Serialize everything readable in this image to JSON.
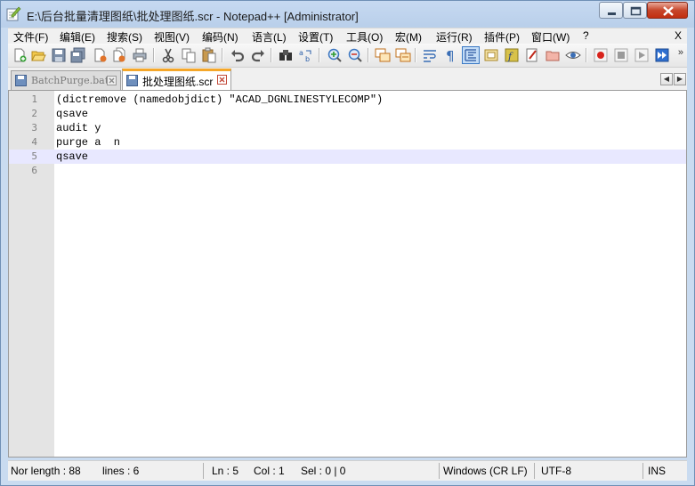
{
  "window": {
    "title": "E:\\后台批量清理图纸\\批处理图纸.scr - Notepad++ [Administrator]"
  },
  "menu": {
    "items": [
      "文件(F)",
      "编辑(E)",
      "搜索(S)",
      "视图(V)",
      "编码(N)",
      "语言(L)",
      "设置(T)",
      "工具(O)",
      "宏(M)",
      "运行(R)",
      "插件(P)",
      "窗口(W)",
      "?"
    ],
    "close": "X"
  },
  "toolbar": {
    "icons": [
      "new-file-icon",
      "open-file-icon",
      "save-icon",
      "save-all-icon",
      "close-icon",
      "close-all-icon",
      "print-icon",
      "cut-icon",
      "copy-icon",
      "paste-icon",
      "undo-icon",
      "redo-icon",
      "find-icon",
      "replace-icon",
      "zoom-in-icon",
      "zoom-out-icon",
      "sync-vertical-icon",
      "sync-horizontal-icon",
      "word-wrap-icon",
      "show-all-chars-icon",
      "indent-guide-icon",
      "document-map-icon",
      "function-list-icon",
      "doc-monitor-icon",
      "folder-workspace-icon",
      "eye-icon",
      "record-macro-icon",
      "stop-macro-icon",
      "play-macro-icon",
      "run-macro-multiple-icon"
    ],
    "more": "»"
  },
  "tabs": [
    {
      "label": "BatchPurge.bat",
      "active": false
    },
    {
      "label": "批处理图纸.scr",
      "active": true
    }
  ],
  "editor": {
    "lines": [
      {
        "num": "1",
        "text": "(dictremove (namedobjdict) \"ACAD_DGNLINESTYLECOMP\")"
      },
      {
        "num": "2",
        "text": "qsave"
      },
      {
        "num": "3",
        "text": "audit y"
      },
      {
        "num": "4",
        "text": "purge a  n"
      },
      {
        "num": "5",
        "text": "qsave"
      },
      {
        "num": "6",
        "text": ""
      }
    ],
    "current_line": 5
  },
  "status": {
    "length": "Nor length : 88",
    "lines": "lines : 6",
    "ln": "Ln : 5",
    "col": "Col : 1",
    "sel": "Sel : 0 | 0",
    "eol": "Windows (CR LF)",
    "encoding": "UTF-8",
    "mode": "INS"
  },
  "colors": {
    "tab_accent": "#f5a72a",
    "current_line": "#e8e8ff",
    "gutter": "#e4e4e4"
  }
}
